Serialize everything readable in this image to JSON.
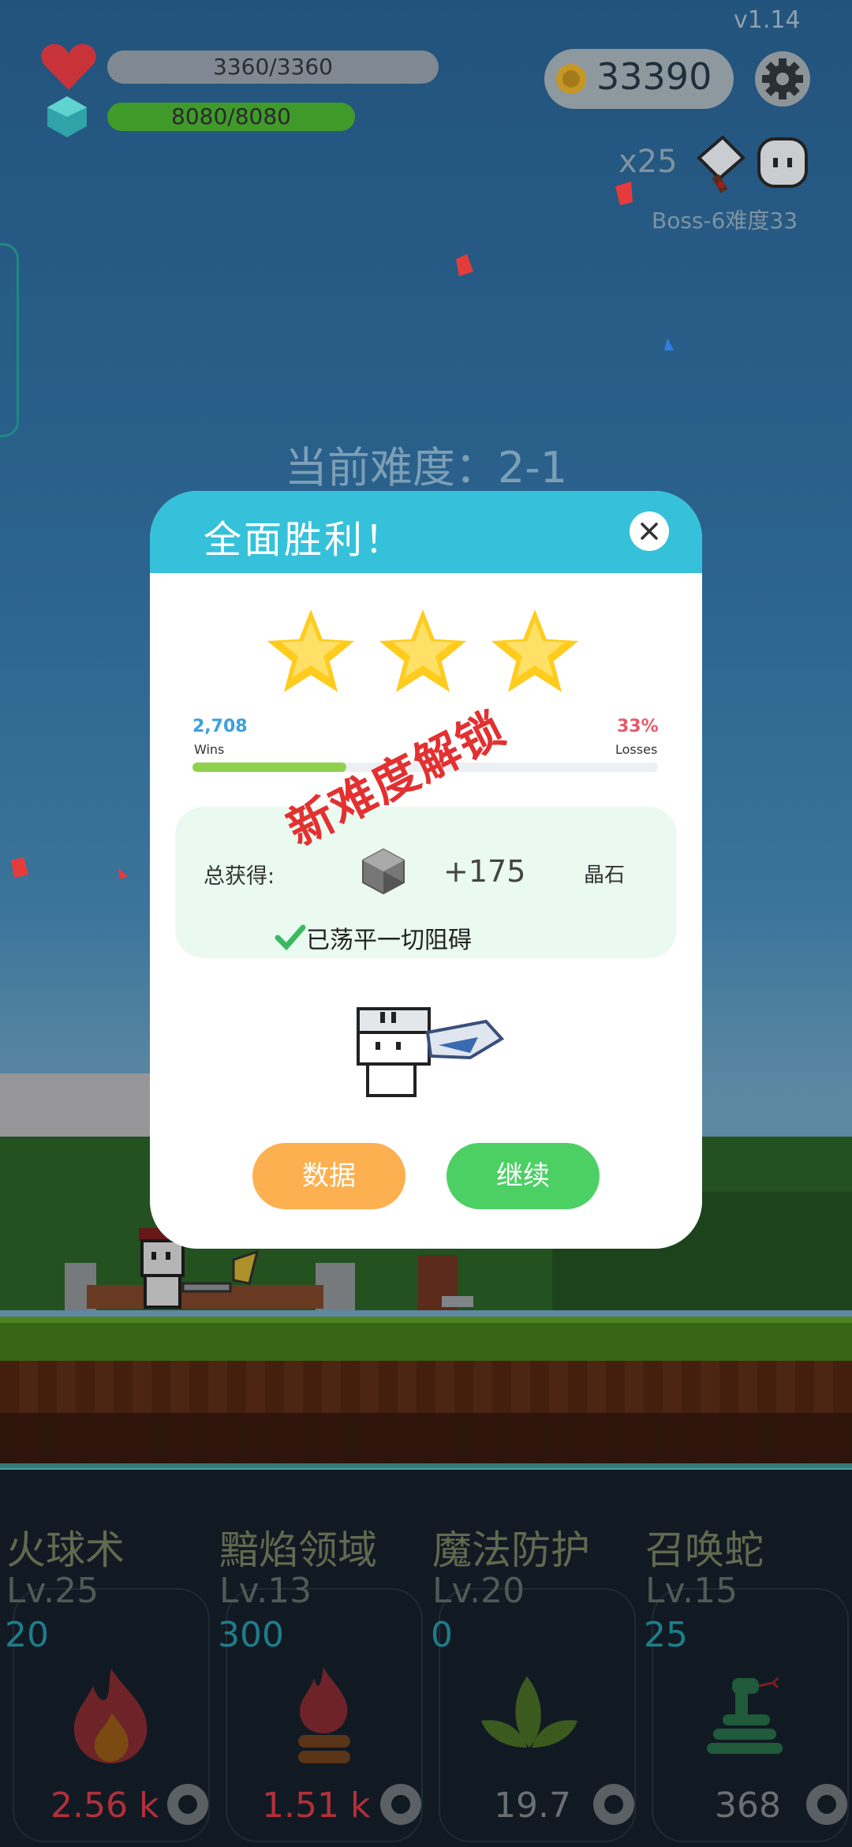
{
  "version": "v1.14",
  "hud": {
    "hp_text": "3360/3360",
    "mp_text": "8080/8080",
    "coins": "33390",
    "multiplier": "x25",
    "boss_label": "Boss-6难度33"
  },
  "difficulty_label": "当前难度：2-1",
  "dialog": {
    "title": "全面胜利！",
    "stars": 3,
    "wins_value": "2,708",
    "wins_label": "Wins",
    "losses_value": "33%",
    "losses_label": "Losses",
    "progress_fraction": 0.33,
    "stamp_text": "新难度解锁",
    "reward_total_label": "总获得:",
    "reward_amount": "+175",
    "reward_unit": "晶石",
    "cleared_text": "已荡平一切阻碍",
    "btn_data": "数据",
    "btn_continue": "继续"
  },
  "skills": [
    {
      "name": "火球术",
      "level": "Lv.25",
      "cost": "20",
      "value": "2.56 k",
      "value_color": "#b0303a",
      "icon": "fire-icon"
    },
    {
      "name": "黯焰领域",
      "level": "Lv.13",
      "cost": "300",
      "value": "1.51 k",
      "value_color": "#b0303a",
      "icon": "campfire-icon"
    },
    {
      "name": "魔法防护",
      "level": "Lv.20",
      "cost": "0",
      "value": "19.7",
      "value_color": "#6b6f72",
      "icon": "leaf-icon"
    },
    {
      "name": "召唤蛇",
      "level": "Lv.15",
      "cost": "25",
      "value": "368",
      "value_color": "#6b6f72",
      "icon": "snake-icon"
    }
  ]
}
